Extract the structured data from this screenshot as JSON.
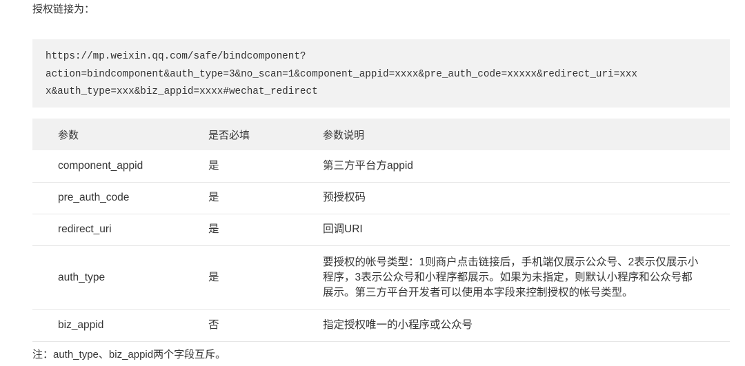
{
  "intro_text": "授权链接为：",
  "code": {
    "lines": [
      "https://mp.weixin.qq.com/safe/bindcomponent?",
      "action=bindcomponent&auth_type=3&no_scan=1&component_appid=xxxx&pre_auth_code=xxxxx&redirect_uri=xxx",
      "x&auth_type=xxx&biz_appid=xxxx#wechat_redirect"
    ]
  },
  "table": {
    "headers": [
      "参数",
      "是否必填",
      "参数说明"
    ],
    "rows": [
      {
        "param": "component_appid",
        "required": "是",
        "desc": "第三方平台方appid"
      },
      {
        "param": "pre_auth_code",
        "required": "是",
        "desc": "预授权码"
      },
      {
        "param": "redirect_uri",
        "required": "是",
        "desc": "回调URI"
      },
      {
        "param": "auth_type",
        "required": "是",
        "desc": "要授权的帐号类型：1则商户点击链接后，手机端仅展示公众号、2表示仅展示小程序，3表示公众号和小程序都展示。如果为未指定，则默认小程序和公众号都展示。第三方平台开发者可以使用本字段来控制授权的帐号类型。"
      },
      {
        "param": "biz_appid",
        "required": "否",
        "desc": "指定授权唯一的小程序或公众号"
      }
    ]
  },
  "note_text": "注：auth_type、biz_appid两个字段互斥。"
}
